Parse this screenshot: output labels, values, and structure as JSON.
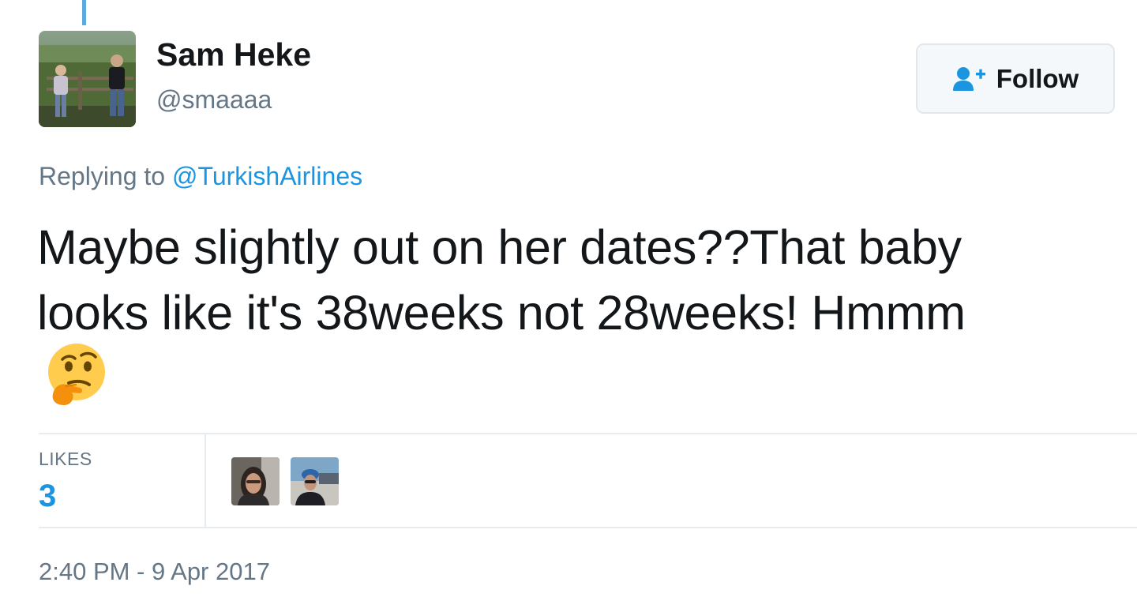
{
  "tweet": {
    "author": {
      "display_name": "Sam Heke",
      "handle": "@smaaaa"
    },
    "follow_label": "Follow",
    "reply": {
      "prefix": "Replying to",
      "mention": "@TurkishAirlines"
    },
    "text_lines": [
      "Maybe slightly out on her dates??That baby",
      "looks like it's 38weeks not 28weeks! Hmmm"
    ],
    "emoji": "thinking-face",
    "stats": {
      "likes_label": "LIKES",
      "likes_count": "3"
    },
    "timestamp": "2:40 PM - 9 Apr 2017"
  },
  "colors": {
    "link_blue": "#1b95e0",
    "secondary_text": "#657786",
    "primary_text": "#14171a",
    "thread_line": "#5ea9dd",
    "border": "#e6ecf0"
  }
}
